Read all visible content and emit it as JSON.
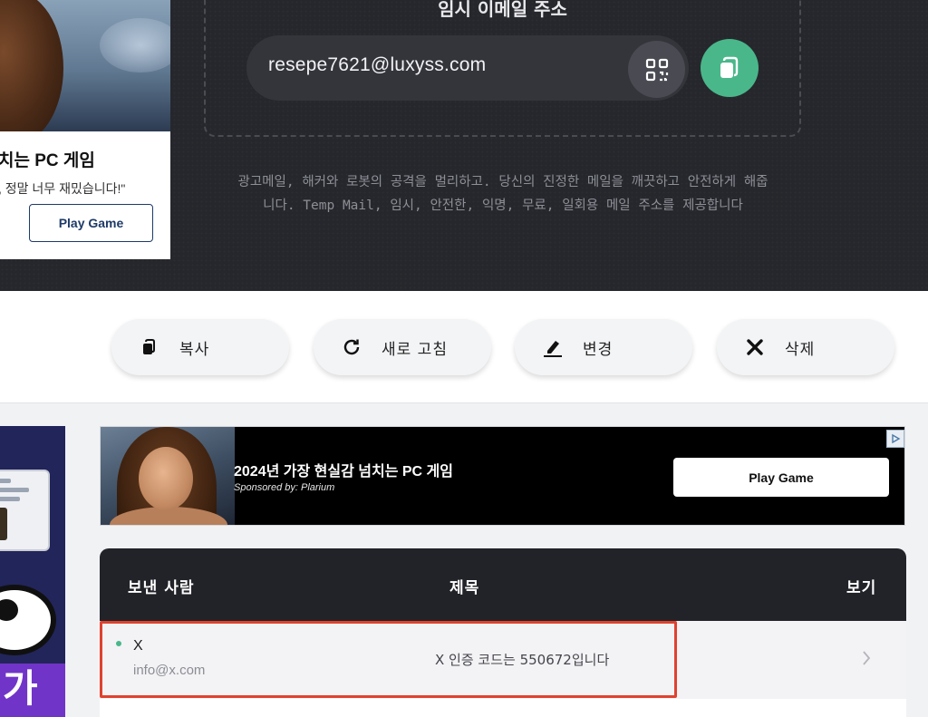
{
  "side_ad_card": {
    "title": "치는 PC 게임",
    "description": ", 정말 너무 재밌습니다!\"",
    "button_label": "Play Game"
  },
  "email_box": {
    "label": "임시 이메일 주소",
    "address": "resepe7621@luxyss.com",
    "qr_icon": "qr-code-icon",
    "copy_icon": "copy-icon"
  },
  "hero": {
    "description_line1": "광고메일, 해커와 로봇의 공격을 멀리하고. 당신의 진정한 메일을 깨끗하고 안전하게 해줍",
    "description_line2": "니다. Temp Mail, 임시, 안전한, 익명, 무료, 일회용 메일 주소를 제공합니다"
  },
  "actions": [
    {
      "label": "복사",
      "icon": "copy-icon"
    },
    {
      "label": "새로 고침",
      "icon": "refresh-icon"
    },
    {
      "label": "변경",
      "icon": "edit-icon"
    },
    {
      "label": "삭제",
      "icon": "close-icon"
    }
  ],
  "left_ad": {
    "text": "가"
  },
  "banner_ad": {
    "title": "2024년 가장 현실감 넘치는 PC 게임",
    "sponsor": "Sponsored by: Plarium",
    "button_label": "Play Game"
  },
  "inbox": {
    "columns": {
      "sender": "보낸 사람",
      "subject": "제목",
      "view": "보기"
    },
    "rows": [
      {
        "sender_name": "X",
        "sender_email": "info@x.com",
        "subject": "X 인증 코드는 550672입니다",
        "unread": true
      }
    ]
  },
  "colors": {
    "hero_bg": "#26272c",
    "accent_green": "#49b78a",
    "highlight_red": "#e0412f",
    "inbox_header_bg": "#222329"
  }
}
